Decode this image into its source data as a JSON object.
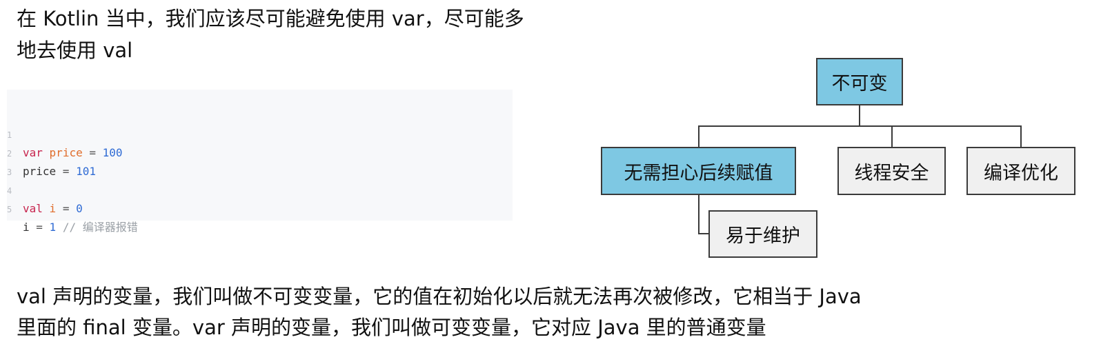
{
  "intro": {
    "line1": "在 Kotlin 当中，我们应该尽可能避免使用 var，尽可能多",
    "line2": "地去使用 val"
  },
  "code": {
    "lines": [
      {
        "num": "1",
        "tokens": [
          [
            "kw",
            "var"
          ],
          [
            "plain",
            " "
          ],
          [
            "id",
            "price"
          ],
          [
            "op",
            " = "
          ],
          [
            "num",
            "100"
          ]
        ]
      },
      {
        "num": "2",
        "tokens": [
          [
            "plain",
            "price"
          ],
          [
            "op",
            " = "
          ],
          [
            "num",
            "101"
          ]
        ]
      },
      {
        "num": "3",
        "tokens": []
      },
      {
        "num": "4",
        "tokens": [
          [
            "kw",
            "val"
          ],
          [
            "plain",
            " "
          ],
          [
            "id",
            "i"
          ],
          [
            "op",
            " = "
          ],
          [
            "num",
            "0"
          ]
        ]
      },
      {
        "num": "5",
        "tokens": [
          [
            "plain",
            "i"
          ],
          [
            "op",
            " = "
          ],
          [
            "num",
            "1"
          ],
          [
            "plain",
            " "
          ],
          [
            "cmt",
            "// 编译器报错"
          ]
        ]
      }
    ]
  },
  "diagram": {
    "root": "不可变",
    "children": [
      "无需担心后续赋值",
      "线程安全",
      "编译优化"
    ],
    "grandchild": "易于维护",
    "highlight_color": "#7ec8e3",
    "plain_color": "#f0f0f0"
  },
  "outro": {
    "line1": "val 声明的变量，我们叫做不可变变量，它的值在初始化以后就无法再次被修改，它相当于 Java",
    "line2": "里面的 final 变量。var 声明的变量，我们叫做可变变量，它对应 Java 里的普通变量"
  }
}
